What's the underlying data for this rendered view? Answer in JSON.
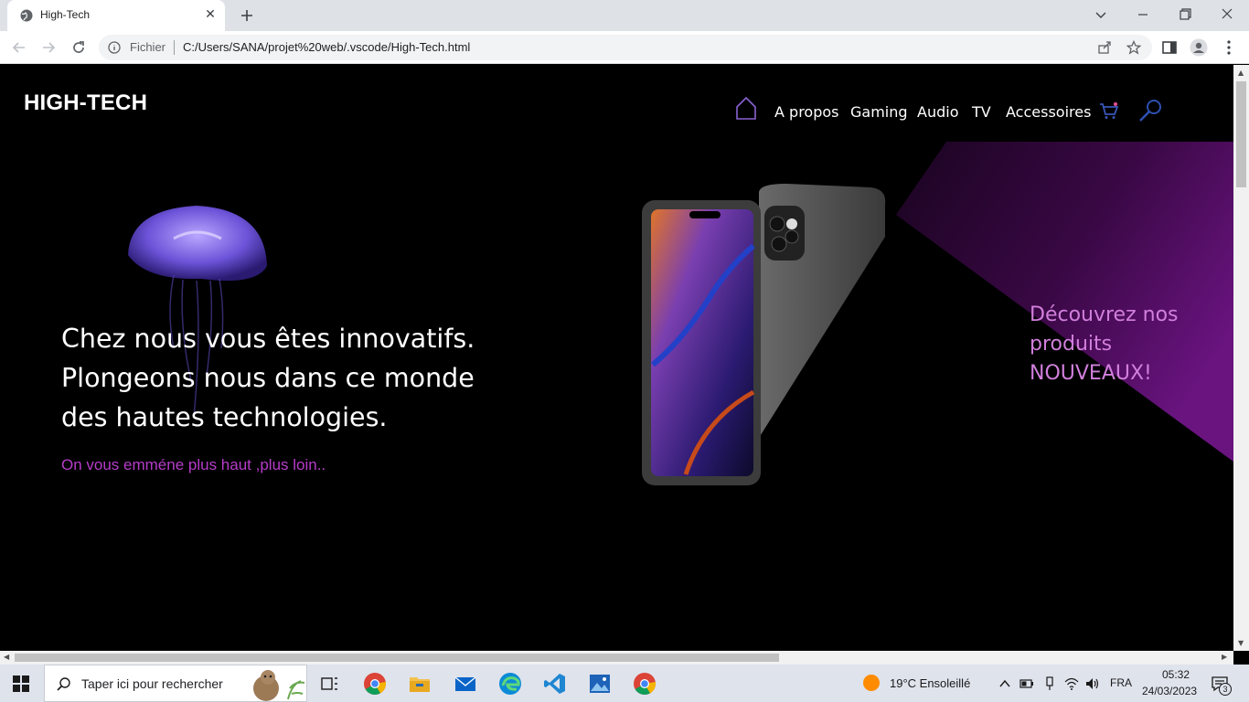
{
  "browser": {
    "tab_title": "High-Tech",
    "security_label": "Fichier",
    "url": "C:/Users/SANA/projet%20web/.vscode/High-Tech.html"
  },
  "page": {
    "logo": "HIGH-TECH",
    "nav": {
      "items": [
        "A propos",
        "Gaming",
        "Audio",
        "TV",
        "Accessoires"
      ]
    },
    "headline": "Chez nous vous êtes innovatifs. Plongeons nous dans ce monde des hautes technologies.",
    "tagline": "On vous emméne plus haut ,plus loin..",
    "promo": {
      "line1": "Découvrez nos",
      "line2": "produits",
      "line3": "NOUVEAUX!"
    },
    "colors": {
      "accent": "#b63cc9",
      "promo": "#d17fdc",
      "background": "#000000"
    }
  },
  "taskbar": {
    "search_placeholder": "Taper ici pour rechercher",
    "weather": "19°C  Ensoleillé",
    "language": "FRA",
    "time": "05:32",
    "date": "24/03/2023",
    "notification_count": "3"
  }
}
